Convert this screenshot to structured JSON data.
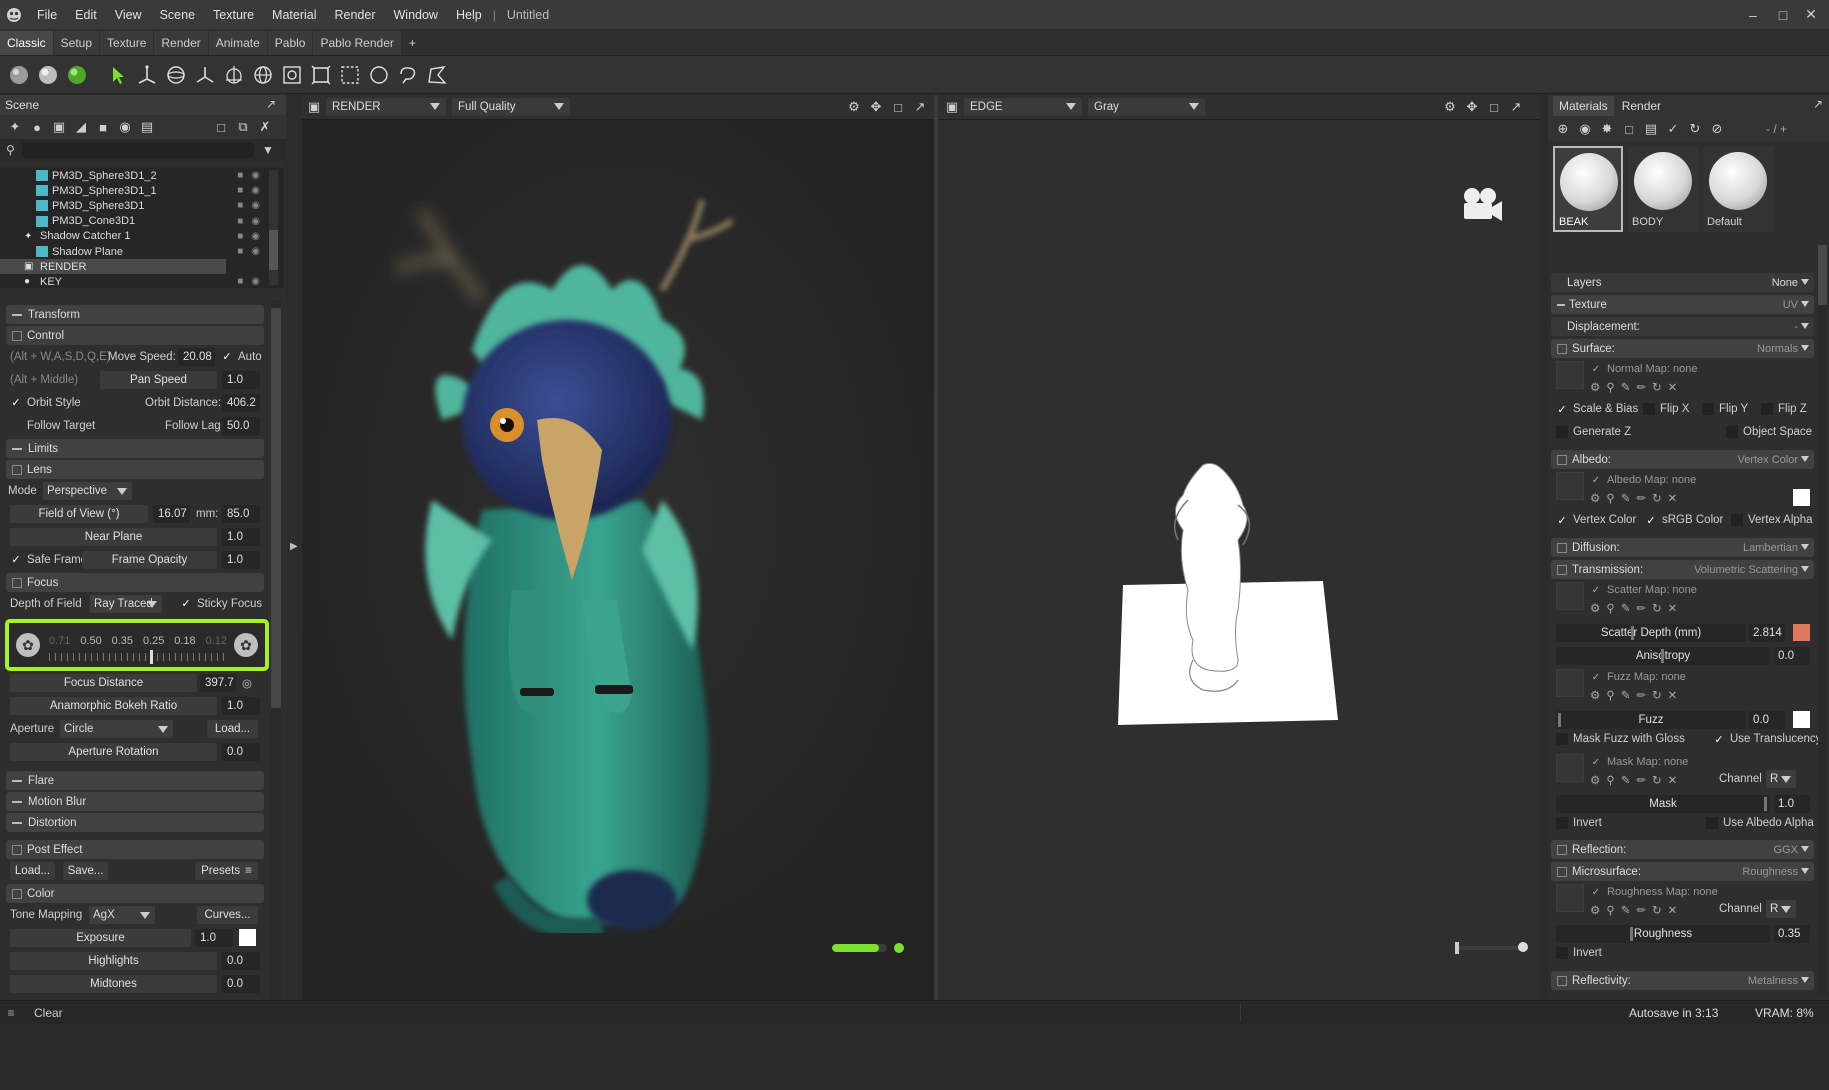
{
  "menu": [
    "File",
    "Edit",
    "View",
    "Scene",
    "Texture",
    "Material",
    "Render",
    "Window",
    "Help"
  ],
  "doc_title": "Untitled",
  "tabs": [
    "Classic",
    "Setup",
    "Texture",
    "Render",
    "Animate",
    "Pablo",
    "Pablo Render",
    "+"
  ],
  "scene": {
    "title": "Scene",
    "tree": [
      {
        "label": "PM3D_Sphere3D1_2",
        "icon": "cube-icon"
      },
      {
        "label": "PM3D_Sphere3D1_1",
        "icon": "cube-icon"
      },
      {
        "label": "PM3D_Sphere3D1",
        "icon": "cube-icon"
      },
      {
        "label": "PM3D_Cone3D1",
        "icon": "cube-icon"
      },
      {
        "label": "Shadow Catcher 1",
        "icon": "light-icon"
      },
      {
        "label": "Shadow Plane",
        "icon": "cube-icon"
      },
      {
        "label": "RENDER",
        "icon": "camera-icon",
        "selected": true
      },
      {
        "label": "KEY",
        "icon": "light-icon"
      }
    ]
  },
  "props": {
    "transform": "Transform",
    "control": "Control",
    "ctrl_hint1": "(Alt + W,A,S,D,Q,E)",
    "move_speed_label": "Move Speed:",
    "move_speed": "20.08",
    "auto_label": "Auto",
    "ctrl_hint2": "(Alt + Middle)",
    "pan_speed_label": "Pan Speed",
    "pan_speed": "1.0",
    "orbit_style": "Orbit Style",
    "orbit_distance_label": "Orbit Distance:",
    "orbit_distance": "406.2",
    "follow_target": "Follow Target",
    "follow_lag_label": "Follow Lag",
    "follow_lag": "50.0",
    "limits": "Limits",
    "lens": "Lens",
    "mode_label": "Mode",
    "mode_value": "Perspective",
    "fov_label": "Field of View (°)",
    "fov": "16.07",
    "mm_label": "mm:",
    "mm": "85.0",
    "near_plane_label": "Near Plane",
    "near_plane": "1.0",
    "safe_frame": "Safe Frame",
    "frame_opacity_label": "Frame Opacity",
    "frame_opacity": "1.0",
    "focus": "Focus",
    "dof_label": "Depth of Field",
    "dof_value": "Ray Traced",
    "sticky_focus": "Sticky Focus",
    "fstops": [
      "0.71",
      "0.50",
      "0.35",
      "0.25",
      "0.18",
      "0.12"
    ],
    "focus_distance_label": "Focus Distance",
    "focus_distance": "397.7",
    "anamorphic_label": "Anamorphic Bokeh Ratio",
    "anamorphic": "1.0",
    "aperture_label": "Aperture",
    "aperture_value": "Circle",
    "load": "Load...",
    "aperture_rotation_label": "Aperture Rotation",
    "aperture_rotation": "0.0",
    "flare": "Flare",
    "motion_blur": "Motion Blur",
    "distortion": "Distortion",
    "post_effect": "Post Effect",
    "save": "Save...",
    "presets": "Presets",
    "color": "Color",
    "tone_mapping_label": "Tone Mapping",
    "tone_mapping": "AgX",
    "curves": "Curves...",
    "exposure_label": "Exposure",
    "exposure": "1.0",
    "highlights_label": "Highlights",
    "highlights": "0.0",
    "midtones_label": "Midtones",
    "midtones": "0.0"
  },
  "viewport1": {
    "mode": "RENDER",
    "quality": "Full Quality",
    "progress": 0.85
  },
  "viewport2": {
    "mode": "EDGE",
    "shade": "Gray"
  },
  "materials": {
    "tabs": [
      "Materials",
      "Render"
    ],
    "counter": "- / +",
    "swatches": [
      {
        "name": "BEAK",
        "selected": true
      },
      {
        "name": "BODY"
      },
      {
        "name": "Default"
      }
    ],
    "layers_label": "Layers",
    "layers_value": "None",
    "texture_label": "Texture",
    "texture_value": "UV",
    "displacement_label": "Displacement:",
    "displacement_value": "-",
    "surface_label": "Surface:",
    "surface_value": "Normals",
    "normal_map": "Normal Map: none",
    "scale_bias": "Scale & Bias",
    "flip_x": "Flip X",
    "flip_y": "Flip Y",
    "flip_z": "Flip Z",
    "generate_z": "Generate Z",
    "object_space": "Object Space",
    "albedo_label": "Albedo:",
    "albedo_value": "Vertex Color",
    "albedo_map": "Albedo Map: none",
    "vertex_color": "Vertex Color",
    "srgb_color": "sRGB Color",
    "vertex_alpha": "Vertex Alpha",
    "diffusion_label": "Diffusion:",
    "diffusion_value": "Lambertian",
    "transmission_label": "Transmission:",
    "transmission_value": "Volumetric Scattering",
    "scatter_map": "Scatter Map: none",
    "scatter_depth_label": "Scatter Depth (mm)",
    "scatter_depth": "2.814",
    "anisotropy_label": "Anisotropy",
    "anisotropy": "0.0",
    "fuzz_map": "Fuzz Map: none",
    "fuzz_label": "Fuzz",
    "fuzz": "0.0",
    "mask_fuzz": "Mask Fuzz with Gloss",
    "use_translucency": "Use Translucency",
    "mask_map": "Mask Map: none",
    "channel_label": "Channel",
    "channel": "R",
    "mask_label": "Mask",
    "mask": "1.0",
    "invert": "Invert",
    "use_albedo_alpha": "Use Albedo Alpha",
    "reflection_label": "Reflection:",
    "reflection_value": "GGX",
    "microsurface_label": "Microsurface:",
    "microsurface_value": "Roughness",
    "roughness_map": "Roughness Map: none",
    "channel2": "R",
    "roughness_label": "Roughness",
    "roughness": "0.35",
    "invert2": "Invert",
    "reflectivity_label": "Reflectivity:",
    "reflectivity_value": "Metalness"
  },
  "status": {
    "clear": "Clear",
    "autosave": "Autosave in 3:13",
    "vram": "VRAM: 8%"
  },
  "colors": {
    "accent": "#7ee030",
    "scatter_swatch": "#e07a5f",
    "highlight_box": "#a6f22a"
  }
}
